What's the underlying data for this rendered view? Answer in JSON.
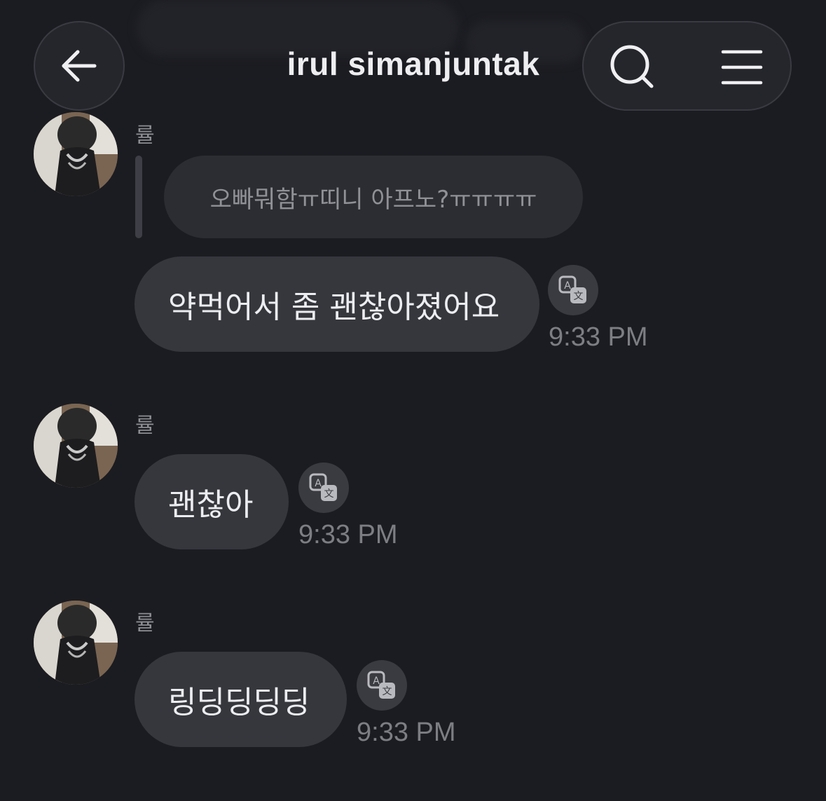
{
  "header": {
    "title": "irul simanjuntak",
    "back_icon": "arrow-left-icon",
    "search_icon": "search-icon",
    "menu_icon": "menu-icon"
  },
  "reply": {
    "text": "오빠뭐함ㅠ띠니 아프노?ㅠㅠㅠㅠ"
  },
  "messages": [
    {
      "sender": "률",
      "text": "약먹어서 좀 괜찮아졌어요",
      "time": "9:33 PM"
    },
    {
      "sender": "률",
      "text": "괜찮아",
      "time": "9:33 PM"
    },
    {
      "sender": "률",
      "text": "링딩딩딩딩",
      "time": "9:33 PM"
    }
  ],
  "colors": {
    "background": "#1b1c21",
    "bubble": "#36373d",
    "reply_bubble": "#2c2d33",
    "muted_text": "#7d7e84"
  }
}
